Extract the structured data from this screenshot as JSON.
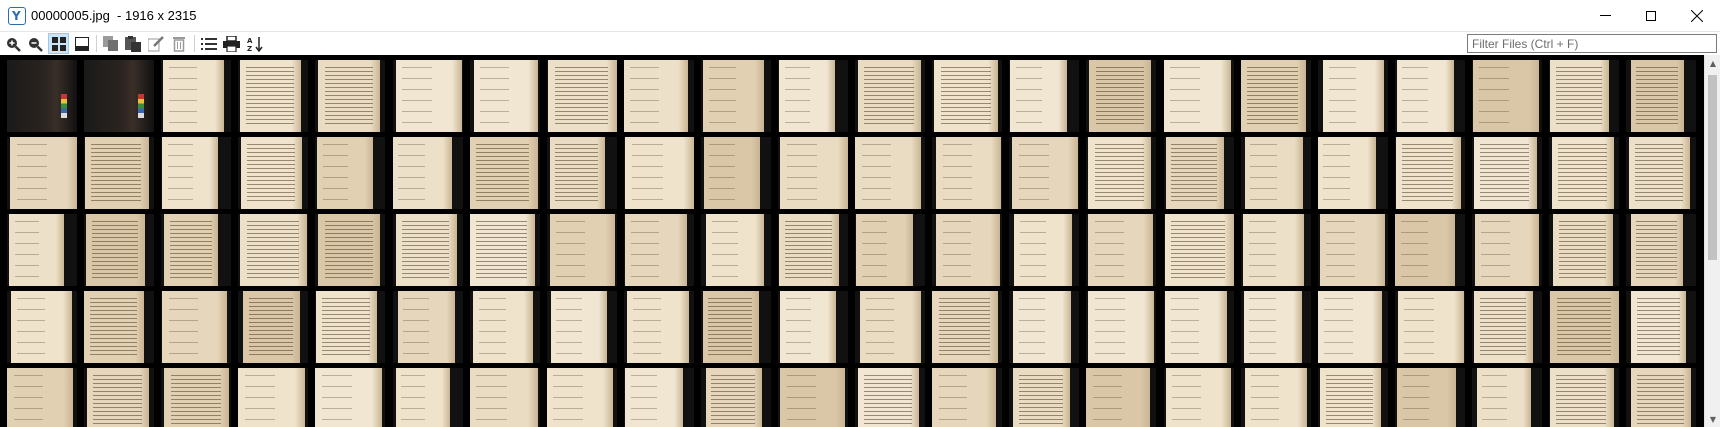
{
  "window": {
    "title": "00000005.jpg  - 1916 x 2315",
    "app_icon_glyph": "Y",
    "controls": [
      "minimize",
      "maximize",
      "close"
    ]
  },
  "toolbar": {
    "buttons": [
      {
        "name": "zoom-in-icon",
        "active": false
      },
      {
        "name": "zoom-out-icon",
        "active": false
      },
      {
        "name": "thumbnail-grid-icon",
        "active": true
      },
      {
        "name": "filmstrip-view-icon",
        "active": false
      },
      {
        "name": "copy-icon",
        "active": false
      },
      {
        "name": "paste-icon",
        "active": false
      },
      {
        "name": "rename-icon",
        "active": false
      },
      {
        "name": "delete-icon",
        "active": false
      },
      {
        "name": "list-view-icon",
        "active": false
      },
      {
        "name": "print-icon",
        "active": false
      },
      {
        "name": "sort-az-icon",
        "active": false
      }
    ],
    "filter_placeholder": "Filter Files (Ctrl + F)"
  },
  "grid": {
    "columns": 22,
    "visible_rows": 5,
    "thumbnails": "Thumbnails of scanned handwritten ledger pages (cream paper on black background); first two frames are dark photos with color calibration strips"
  },
  "colors": {
    "grid_background": "#000000",
    "paper": "#e9dcc4",
    "ink": "#6b5a48",
    "accent": "#2b6cb0"
  }
}
